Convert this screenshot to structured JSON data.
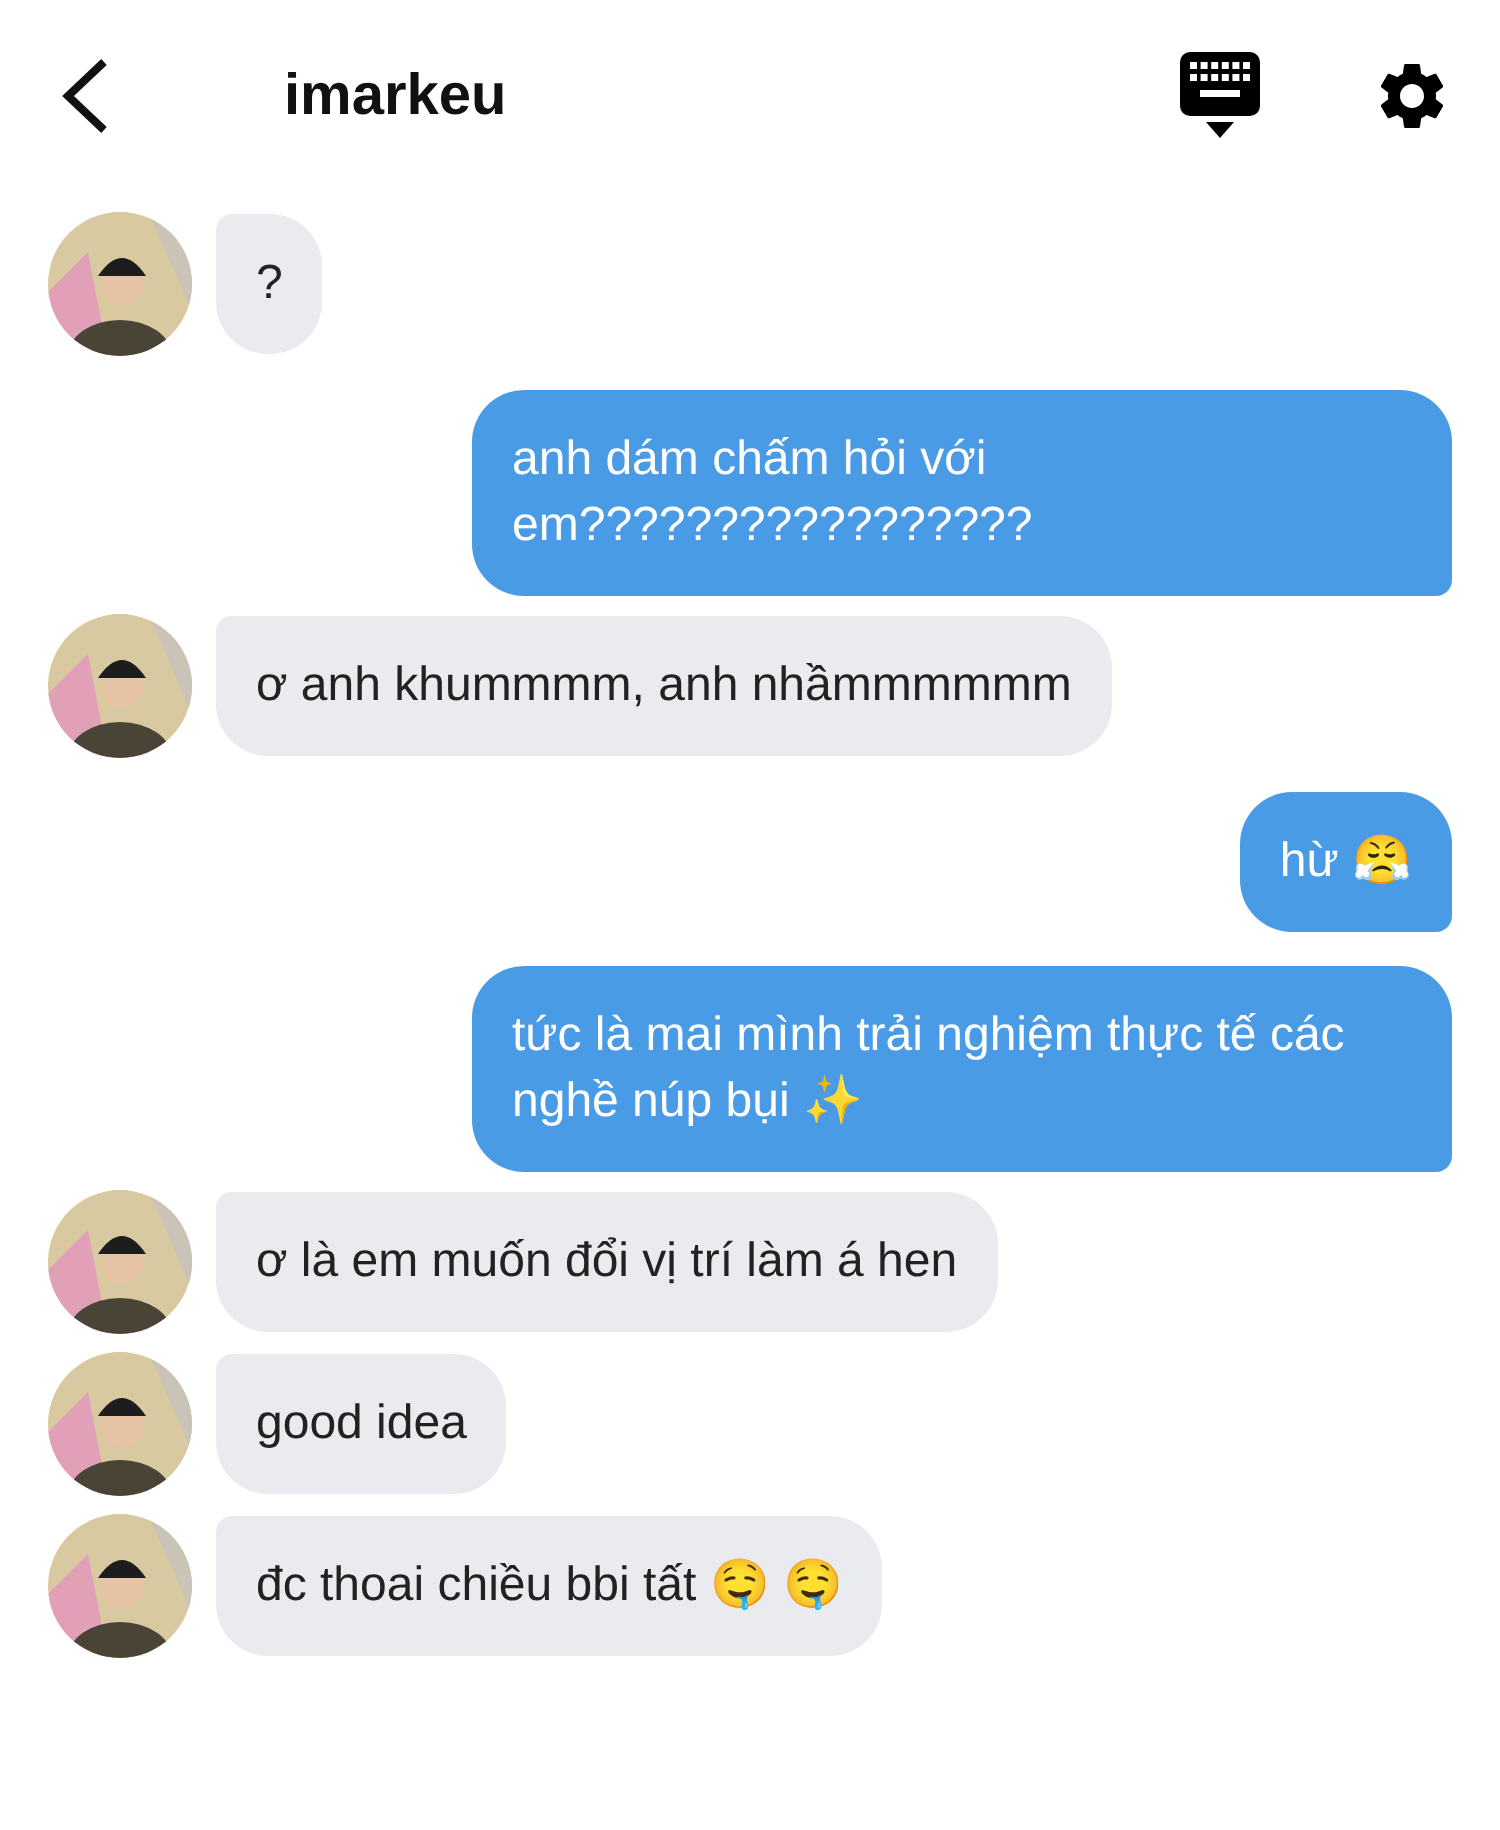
{
  "header": {
    "title": "imarkeu"
  },
  "messages": [
    {
      "kind": "incoming",
      "text": "?"
    },
    {
      "kind": "outgoing",
      "text": "anh dám chấm hỏi với em?????????????????"
    },
    {
      "kind": "incoming",
      "text": "ơ anh khummmm, anh nhầmmmmmm"
    },
    {
      "kind": "outgoing",
      "text": "hừ 😤"
    },
    {
      "kind": "outgoing",
      "text": "tức là mai mình trải nghiệm thực tế các nghề núp bụi ✨"
    },
    {
      "kind": "incoming",
      "text": "ơ là em muốn đổi vị trí làm á hen"
    },
    {
      "kind": "incoming",
      "text": "good idea"
    },
    {
      "kind": "incoming",
      "text": "đc thoai chiều bbi tất 🤤 🤤"
    }
  ]
}
